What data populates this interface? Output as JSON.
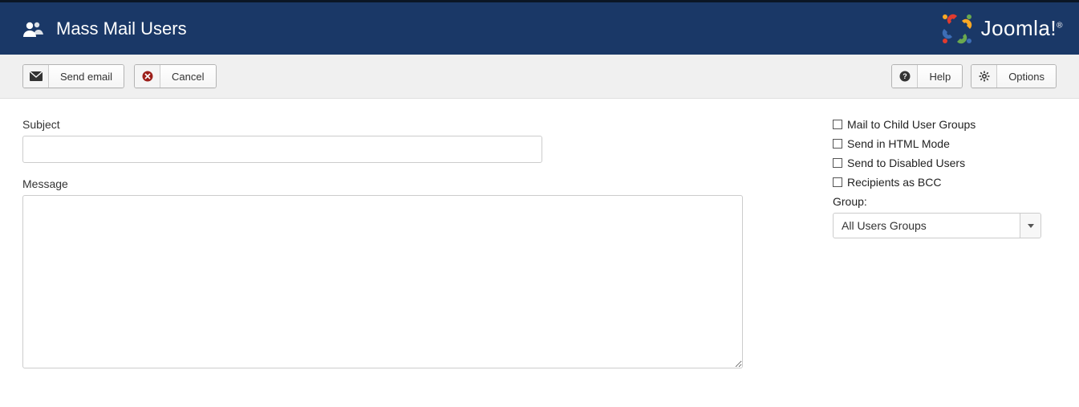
{
  "header": {
    "title": "Mass Mail Users",
    "brand": "Joomla!"
  },
  "toolbar": {
    "send_label": "Send email",
    "cancel_label": "Cancel",
    "help_label": "Help",
    "options_label": "Options"
  },
  "form": {
    "subject_label": "Subject",
    "subject_value": "",
    "message_label": "Message",
    "message_value": ""
  },
  "sidebar": {
    "checks": [
      {
        "label": "Mail to Child User Groups"
      },
      {
        "label": "Send in HTML Mode"
      },
      {
        "label": "Send to Disabled Users"
      },
      {
        "label": "Recipients as BCC"
      }
    ],
    "group_label": "Group:",
    "group_selected": "All Users Groups"
  }
}
